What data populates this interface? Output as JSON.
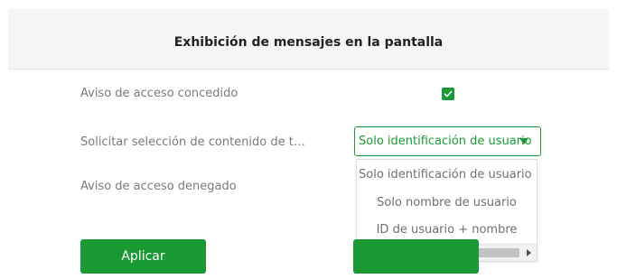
{
  "header": {
    "title": "Exhibición de mensajes en la pantalla"
  },
  "rows": [
    {
      "label": "Aviso de acceso concedido",
      "checked": true
    },
    {
      "label": "Solicitar selección de contenido de t…"
    },
    {
      "label": "Aviso de acceso denegado"
    }
  ],
  "select": {
    "value": "Solo identificación de usuario",
    "options": [
      "Solo identificación de usuario",
      "Solo nombre de usuario",
      "ID de usuario + nombre"
    ]
  },
  "buttons": {
    "apply": "Aplicar",
    "second": ""
  },
  "colors": {
    "accent": "#1a9a35"
  },
  "icons": {
    "check": "check-icon",
    "arrow": "chevron-down-icon"
  }
}
